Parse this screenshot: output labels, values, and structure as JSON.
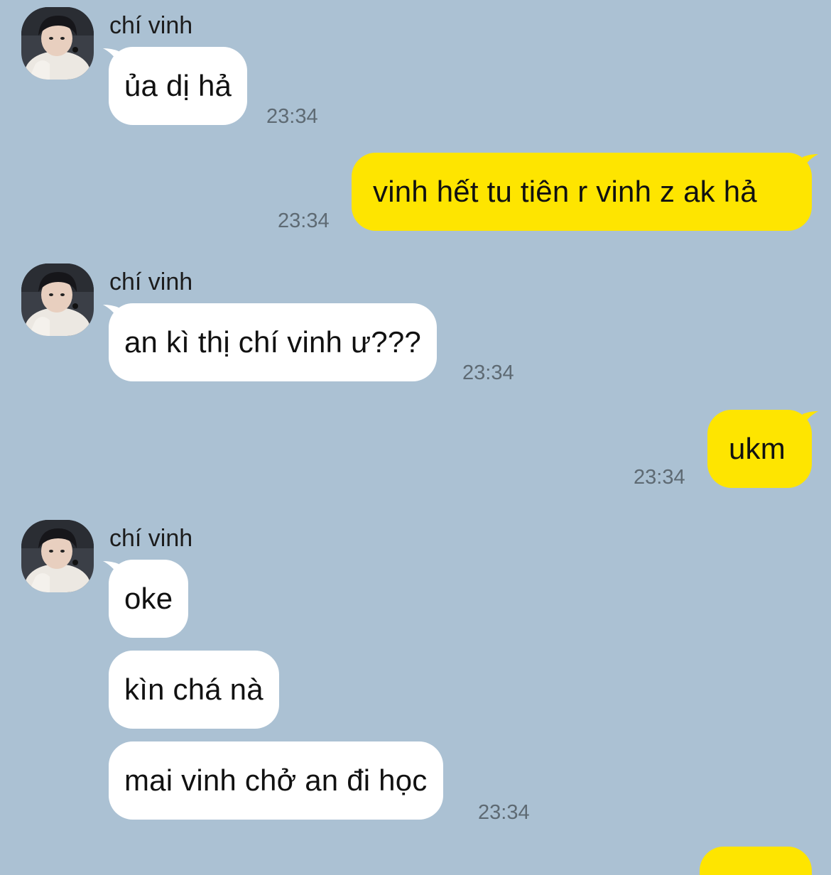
{
  "chat": {
    "colors": {
      "background": "#abc1d3",
      "incoming_bubble": "#ffffff",
      "outgoing_bubble": "#fee500",
      "timestamp": "#5e6a73"
    },
    "messages": [
      {
        "direction": "incoming",
        "sender": "chí vinh",
        "avatar": "profile-photo",
        "bubbles": [
          "ủa dị hả"
        ],
        "time": "23:34"
      },
      {
        "direction": "outgoing",
        "bubbles": [
          "vinh hết tu tiên r vinh z ak hả"
        ],
        "time": "23:34"
      },
      {
        "direction": "incoming",
        "sender": "chí vinh",
        "avatar": "profile-photo",
        "bubbles": [
          "an kì thị chí vinh ư???"
        ],
        "time": "23:34"
      },
      {
        "direction": "outgoing",
        "bubbles": [
          "ukm"
        ],
        "time": "23:34"
      },
      {
        "direction": "incoming",
        "sender": "chí vinh",
        "avatar": "profile-photo",
        "bubbles": [
          "oke",
          "kìn chá nà",
          "mai vinh chở an đi học"
        ],
        "time": "23:34"
      }
    ]
  }
}
